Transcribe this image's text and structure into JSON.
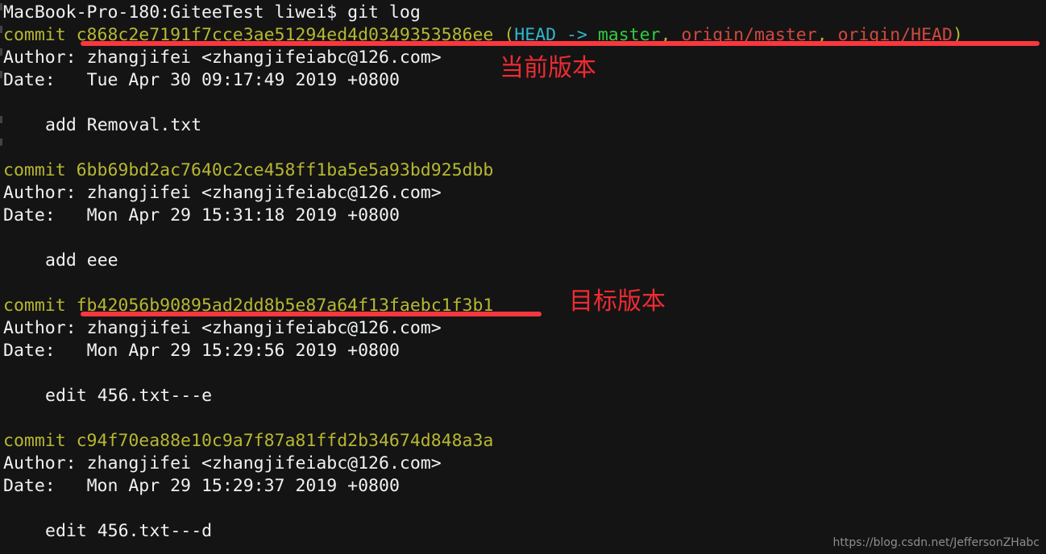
{
  "terminal": {
    "background_color": "#141414",
    "prompt_line": "MacBook-Pro-180:GiteeTest liwei$ git log",
    "colors": {
      "text": "#f0f2f4",
      "commit": "#b7b732",
      "head": "#2fb6cd",
      "branch": "#2ecc3e",
      "remote": "#d1493f",
      "annotation": "#ef2b32"
    },
    "labels": {
      "commit_keyword": "commit ",
      "author_keyword": "Author: ",
      "date_keyword": "Date:   ",
      "author_value": "zhangjifei <zhangjifeiabc@126.com>",
      "paren_open": " (",
      "paren_close": ")",
      "comma": ", ",
      "head_ref": "HEAD -> ",
      "branch_ref": "master",
      "remote_master": "origin/master",
      "remote_head": "origin/HEAD"
    },
    "commits": [
      {
        "hash": "c868c2e7191f7cce3ae51294ed4d0349353586ee",
        "author": "zhangjifei <zhangjifeiabc@126.com>",
        "date": "Tue Apr 30 09:17:49 2019 +0800",
        "message": "add Removal.txt",
        "refs": {
          "head": "HEAD -> ",
          "branch": "master",
          "remote_master": "origin/master",
          "remote_head": "origin/HEAD"
        }
      },
      {
        "hash": "6bb69bd2ac7640c2ce458ff1ba5e5a93bd925dbb",
        "author": "zhangjifei <zhangjifeiabc@126.com>",
        "date": "Mon Apr 29 15:31:18 2019 +0800",
        "message": "add eee"
      },
      {
        "hash": "fb42056b90895ad2dd8b5e87a64f13faebc1f3b1",
        "author": "zhangjifei <zhangjifeiabc@126.com>",
        "date": "Mon Apr 29 15:29:56 2019 +0800",
        "message": "edit 456.txt---e"
      },
      {
        "hash": "c94f70ea88e10c9a7f87a81ffd2b34674d848a3a",
        "author": "zhangjifei <zhangjifeiabc@126.com>",
        "date": "Mon Apr 29 15:29:37 2019 +0800",
        "message": "edit 456.txt---d"
      }
    ]
  },
  "annotations": {
    "current_version": "当前版本",
    "target_version": "目标版本"
  },
  "watermark": "https://blog.csdn.net/JeffersonZHabc"
}
